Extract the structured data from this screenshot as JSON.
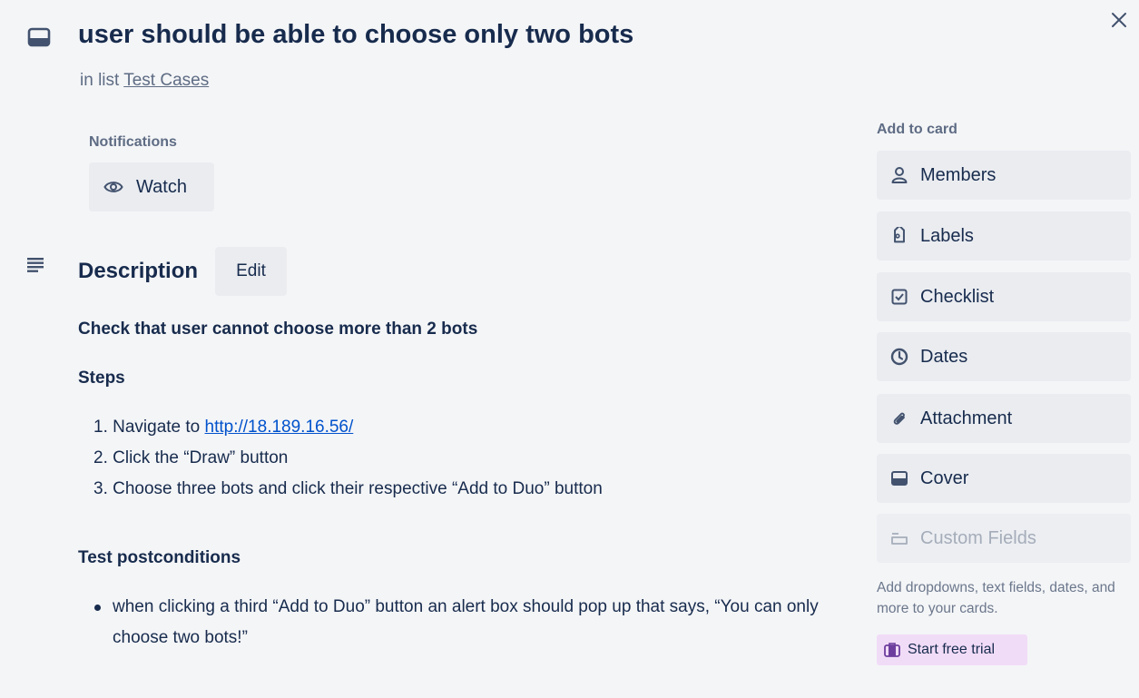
{
  "card": {
    "title": "user should be able to choose only two bots",
    "list_prefix": "in list",
    "list_name": "Test Cases"
  },
  "notifications": {
    "heading": "Notifications",
    "watch_label": "Watch"
  },
  "description": {
    "heading": "Description",
    "edit_label": "Edit",
    "lead": "Check that user cannot choose more than 2 bots",
    "steps_heading": "Steps",
    "steps": [
      {
        "prefix": "1. Navigate to ",
        "link": "http://18.189.16.56/"
      },
      {
        "text": "2. Click the “Draw” button"
      },
      {
        "text": "3. Choose three bots and click their respective “Add to Duo” button"
      }
    ],
    "postconditions_heading": "Test postconditions",
    "postconditions": [
      "when clicking a third “Add to Duo” button an alert box should pop up that says, “You can only choose two bots!”"
    ]
  },
  "sidebar": {
    "heading": "Add to card",
    "items": [
      {
        "label": "Members",
        "icon": "person-icon"
      },
      {
        "label": "Labels",
        "icon": "tag-icon"
      },
      {
        "label": "Checklist",
        "icon": "checkbox-icon"
      },
      {
        "label": "Dates",
        "icon": "clock-icon"
      },
      {
        "label": "Attachment",
        "icon": "paperclip-icon"
      },
      {
        "label": "Cover",
        "icon": "cover-icon"
      },
      {
        "label": "Custom Fields",
        "icon": "custom-fields-icon",
        "disabled": true
      }
    ],
    "custom_fields_note": "Add dropdowns, text fields, dates, and more to your cards.",
    "trial_label": "Start free trial"
  },
  "colors": {
    "background": "#f4f5f7",
    "button": "#eaecf0",
    "link": "#0052cc",
    "trial_bg": "#f1dcf7",
    "text": "#172b4d"
  }
}
